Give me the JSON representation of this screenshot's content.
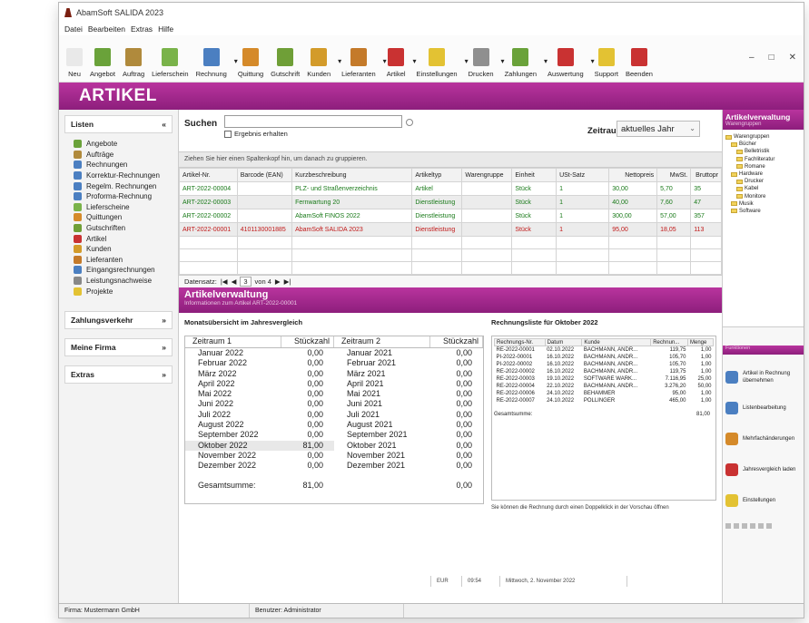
{
  "app": {
    "title": "AbamSoft SALIDA 2023"
  },
  "menu": [
    "Datei",
    "Bearbeiten",
    "Extras",
    "Hilfe"
  ],
  "toolbar": [
    {
      "label": "Neu",
      "color": "#e9e9e9",
      "dd": false
    },
    {
      "label": "Angebot",
      "color": "#6aa23a",
      "dd": false
    },
    {
      "label": "Auftrag",
      "color": "#b08a3c",
      "dd": false
    },
    {
      "label": "Lieferschein",
      "color": "#7ab34a",
      "dd": false
    },
    {
      "label": "Rechnung",
      "color": "#4b7fc1",
      "dd": true
    },
    {
      "label": "Quittung",
      "color": "#d58a2a",
      "dd": false
    },
    {
      "label": "Gutschrift",
      "color": "#6f9f37",
      "dd": false
    },
    {
      "label": "Kunden",
      "color": "#d39b2a",
      "dd": true
    },
    {
      "label": "Lieferanten",
      "color": "#c47a2a",
      "dd": true
    },
    {
      "label": "Artikel",
      "color": "#c93232",
      "dd": true
    },
    {
      "label": "Einstellungen",
      "color": "#e3c233",
      "dd": true
    },
    {
      "label": "Drucken",
      "color": "#8f8f8f",
      "dd": true
    },
    {
      "label": "Zahlungen",
      "color": "#6aa23a",
      "dd": true
    },
    {
      "label": "Auswertung",
      "color": "#c93232",
      "dd": true
    },
    {
      "label": "Support",
      "color": "#e3c233",
      "dd": false
    },
    {
      "label": "Beenden",
      "color": "#c93232",
      "dd": false
    }
  ],
  "banner": {
    "title": "ARTIKEL"
  },
  "sidebar": {
    "listen_title": "Listen",
    "items": [
      {
        "label": "Angebote",
        "color": "#6aa23a"
      },
      {
        "label": "Aufträge",
        "color": "#b08a3c"
      },
      {
        "label": "Rechnungen",
        "color": "#4b7fc1"
      },
      {
        "label": "Korrektur-Rechnungen",
        "color": "#4b7fc1"
      },
      {
        "label": "Regelm. Rechnungen",
        "color": "#4b7fc1"
      },
      {
        "label": "Proforma-Rechnung",
        "color": "#4b7fc1"
      },
      {
        "label": "Lieferscheine",
        "color": "#7ab34a"
      },
      {
        "label": "Quittungen",
        "color": "#d58a2a"
      },
      {
        "label": "Gutschriften",
        "color": "#6f9f37"
      },
      {
        "label": "Artikel",
        "color": "#c93232"
      },
      {
        "label": "Kunden",
        "color": "#d39b2a"
      },
      {
        "label": "Lieferanten",
        "color": "#c47a2a"
      },
      {
        "label": "Eingangsrechnungen",
        "color": "#4b7fc1"
      },
      {
        "label": "Leistungsnachweise",
        "color": "#888888"
      },
      {
        "label": "Projekte",
        "color": "#e3c233"
      }
    ],
    "sections": [
      "Zahlungsverkehr",
      "Meine Firma",
      "Extras"
    ]
  },
  "search": {
    "label": "Suchen",
    "checkbox": "Ergebnis erhalten",
    "zeitraum_label": "Zeitraum",
    "zeitraum_value": "aktuelles Jahr"
  },
  "grid": {
    "hint": "Ziehen Sie hier einen Spaltenkopf hin, um danach zu gruppieren.",
    "columns": [
      "Artikel-Nr.",
      "Barcode (EAN)",
      "Kurzbeschreibung",
      "Artikeltyp",
      "Warengruppe",
      "Einheit",
      "USt-Satz",
      "Nettopreis",
      "MwSt.",
      "Bruttopr"
    ],
    "rows": [
      {
        "cls": "r-green r-white",
        "cells": [
          "ART-2022-00004",
          "",
          "PLZ- und Straßenverzeichnis",
          "Artikel",
          "",
          "Stück",
          "1",
          "30,00",
          "5,70",
          "35"
        ]
      },
      {
        "cls": "r-green r-grey",
        "cells": [
          "ART-2022-00003",
          "",
          "Fernwartung 20",
          "Dienstleistung",
          "",
          "Stück",
          "1",
          "40,00",
          "7,60",
          "47"
        ]
      },
      {
        "cls": "r-green r-white",
        "cells": [
          "ART-2022-00002",
          "",
          "AbamSoft FINOS 2022",
          "Dienstleistung",
          "",
          "Stück",
          "1",
          "300,00",
          "57,00",
          "357"
        ]
      },
      {
        "cls": "r-red r-grey",
        "cells": [
          "ART-2022-00001",
          "4101130001885",
          "AbamSoft SALIDA 2023",
          "Dienstleistung",
          "",
          "Stück",
          "1",
          "95,00",
          "18,05",
          "113"
        ]
      }
    ],
    "pager": {
      "label": "Datensatz:",
      "current": "3",
      "of": "von 4"
    }
  },
  "detail": {
    "title": "Artikelverwaltung",
    "subtitle": "Informationen zum Artikel ART-2022-00001",
    "month_title": "Monatsübersicht im Jahresvergleich",
    "p1_head": "Zeitraum 1",
    "p2_head": "Zeitraum 2",
    "qty_head": "Stückzahl",
    "period1": [
      [
        "Januar 2022",
        "0,00"
      ],
      [
        "Februar 2022",
        "0,00"
      ],
      [
        "März 2022",
        "0,00"
      ],
      [
        "April 2022",
        "0,00"
      ],
      [
        "Mai 2022",
        "0,00"
      ],
      [
        "Juni 2022",
        "0,00"
      ],
      [
        "Juli 2022",
        "0,00"
      ],
      [
        "August 2022",
        "0,00"
      ],
      [
        "September 2022",
        "0,00"
      ],
      [
        "Oktober 2022",
        "81,00"
      ],
      [
        "November 2022",
        "0,00"
      ],
      [
        "Dezember 2022",
        "0,00"
      ]
    ],
    "period2": [
      [
        "Januar 2021",
        "0,00"
      ],
      [
        "Februar 2021",
        "0,00"
      ],
      [
        "März 2021",
        "0,00"
      ],
      [
        "April 2021",
        "0,00"
      ],
      [
        "Mai 2021",
        "0,00"
      ],
      [
        "Juni 2021",
        "0,00"
      ],
      [
        "Juli 2021",
        "0,00"
      ],
      [
        "August 2021",
        "0,00"
      ],
      [
        "September 2021",
        "0,00"
      ],
      [
        "Oktober 2021",
        "0,00"
      ],
      [
        "November 2021",
        "0,00"
      ],
      [
        "Dezember 2021",
        "0,00"
      ]
    ],
    "sum_label": "Gesamtsumme:",
    "sum1": "81,00",
    "sum2": "0,00",
    "invoice_title": "Rechnungsliste für Oktober 2022",
    "invoice_cols": [
      "Rechnungs-Nr.",
      "Datum",
      "Kunde",
      "Rechnun...",
      "Menge"
    ],
    "invoices": [
      [
        "RE-2022-00001",
        "02.10.2022",
        "BACHMANN, ANDR...",
        "119,75",
        "1,00"
      ],
      [
        "PI-2022-00001",
        "16.10.2022",
        "BACHMANN, ANDR...",
        "105,70",
        "1,00"
      ],
      [
        "PI-2022-00002",
        "16.10.2022",
        "BACHMANN, ANDR...",
        "105,70",
        "1,00"
      ],
      [
        "RE-2022-00002",
        "16.10.2022",
        "BACHMANN, ANDR...",
        "119,75",
        "1,00"
      ],
      [
        "RE-2022-00003",
        "19.10.2022",
        "SOFTWARE WARK...",
        "7.116,95",
        "25,00"
      ],
      [
        "RE-2022-00004",
        "22.10.2022",
        "BACHMANN, ANDR...",
        "3.276,20",
        "50,00"
      ],
      [
        "RE-2022-00006",
        "24.10.2022",
        "BEHAMMER",
        "95,00",
        "1,00"
      ],
      [
        "RE-2022-00007",
        "24.10.2022",
        "PÖLLINGER",
        "465,00",
        "1,00"
      ]
    ],
    "invoice_sum_label": "Gesamtsumme:",
    "invoice_sum": "81,00",
    "invoice_note": "Sie können die Rechnung durch einen Doppelklick in der Vorschau öffnen"
  },
  "rpanel": {
    "title": "Artikelverwaltung",
    "subtitle": "Warengruppen",
    "tree": [
      "Warengruppen",
      "Bücher",
      "Belletristik",
      "Fachliteratur",
      "Romane",
      "Hardware",
      "Drucker",
      "Kabel",
      "Monitore",
      "Musik",
      "Software"
    ],
    "functions_title": "Funktionen",
    "functions": [
      {
        "label": "Artikel in Rechnung übernehmen",
        "color": "#4b7fc1"
      },
      {
        "label": "Listenbearbeitung",
        "color": "#4b7fc1"
      },
      {
        "label": "Mehrfachänderungen",
        "color": "#d58a2a"
      },
      {
        "label": "Jahresvergleich laden",
        "color": "#c93232"
      },
      {
        "label": "Einstellungen",
        "color": "#e3c233"
      }
    ]
  },
  "status": {
    "currency": "EUR",
    "time": "09:54",
    "date": "Mittwoch, 2. November 2022",
    "user": "Benutzer: Administrator",
    "company": "Firma: Mustermann GmbH"
  }
}
